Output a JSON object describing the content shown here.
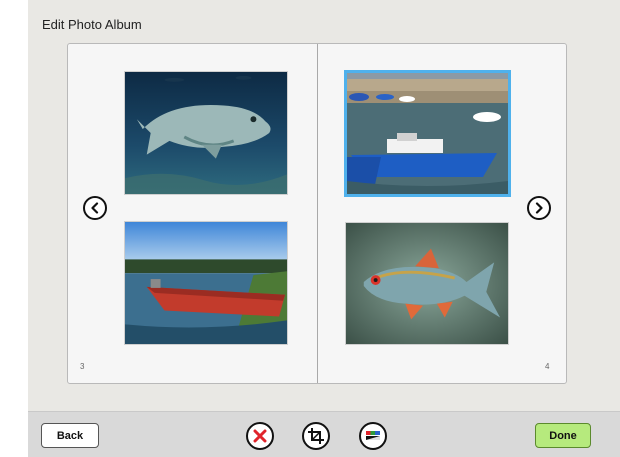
{
  "window": {
    "title": "Edit Photo Album"
  },
  "album": {
    "left_page_number": "3",
    "right_page_number": "4",
    "photos": [
      {
        "name": "grouper-fish-underwater",
        "selected": false
      },
      {
        "name": "blue-boats-harbor",
        "selected": true
      },
      {
        "name": "red-boat-lake",
        "selected": false
      },
      {
        "name": "colorful-fish",
        "selected": false
      }
    ],
    "selection_color": "#4fb1ec"
  },
  "navigation": {
    "prev_icon": "chevron-left-icon",
    "next_icon": "chevron-right-icon"
  },
  "toolbar": {
    "back_label": "Back",
    "done_label": "Done",
    "done_color": "#b6ea7d",
    "delete_icon": "delete-x-icon",
    "crop_icon": "crop-icon",
    "color_icon": "color-adjust-icon",
    "delete_color": "#e0242b"
  }
}
